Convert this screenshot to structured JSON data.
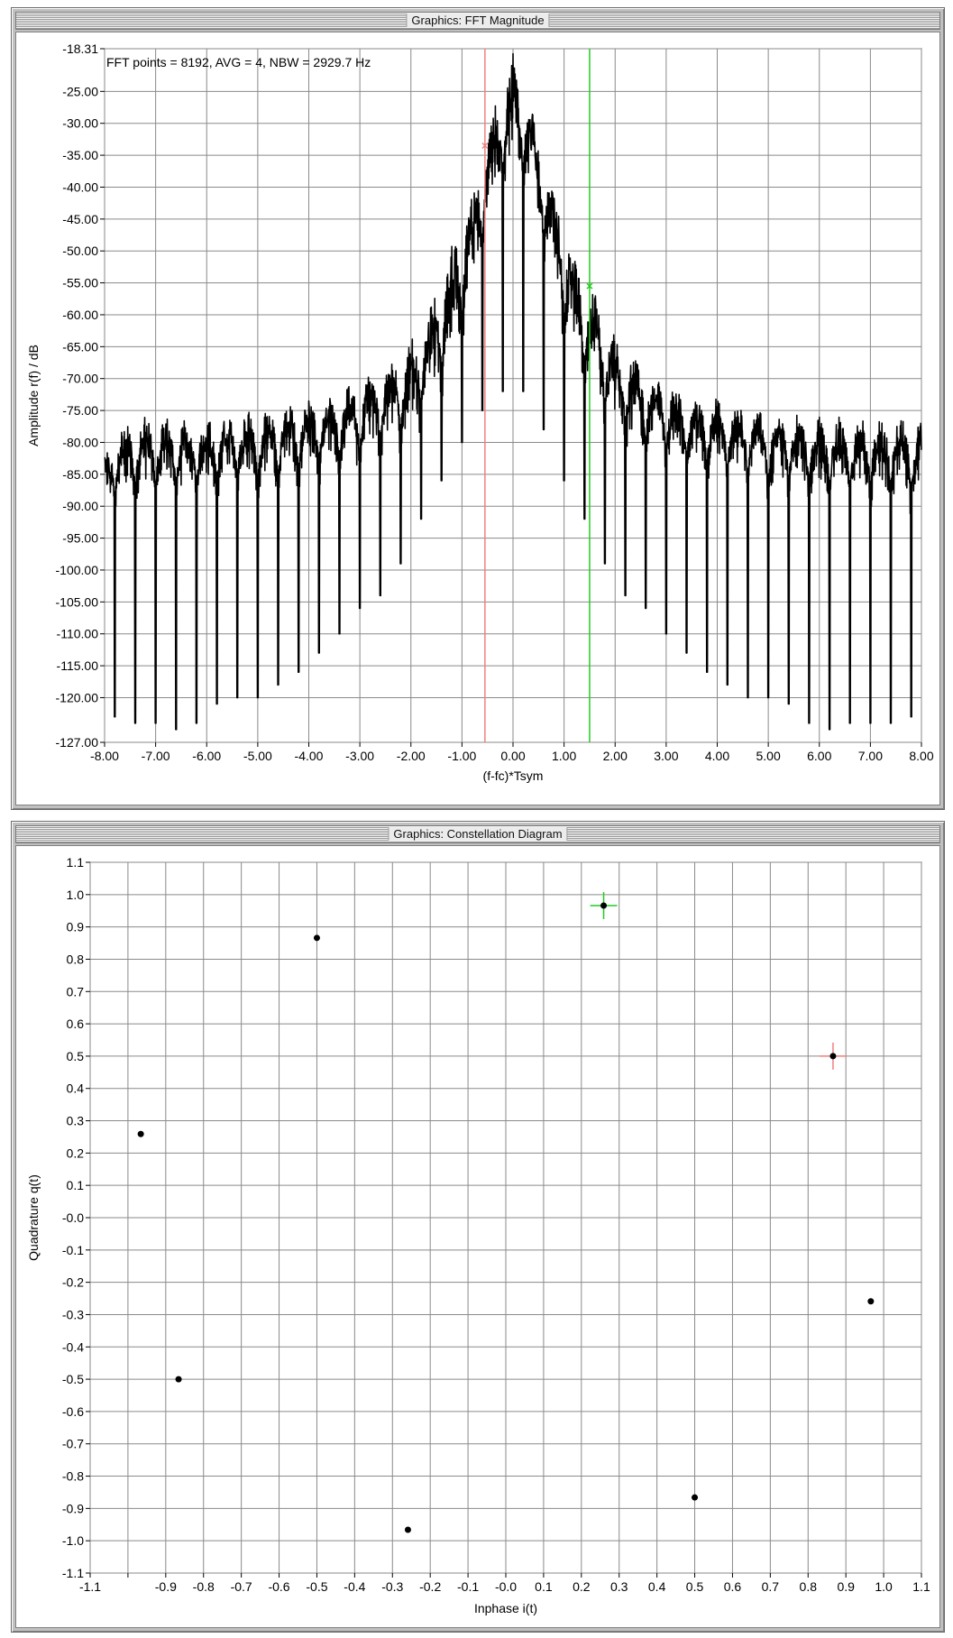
{
  "chart_data": [
    {
      "type": "line",
      "title": "Graphics: FFT Magnitude",
      "annotation": "FFT points = 8192, AVG = 4, NBW = 2929.7 Hz",
      "xlabel": "(f-fc)*Tsym",
      "ylabel": "Amplitude r(f) / dB",
      "xlim": [
        -8.0,
        8.0
      ],
      "ylim": [
        -127.0,
        -18.31
      ],
      "x_ticks": [
        "-8.00",
        "-7.00",
        "-6.00",
        "-5.00",
        "-4.00",
        "-3.00",
        "-2.00",
        "-1.00",
        "0.00",
        "1.00",
        "2.00",
        "3.00",
        "4.00",
        "5.00",
        "6.00",
        "7.00",
        "8.00"
      ],
      "y_ticks": [
        "-18.31",
        "-25.00",
        "-30.00",
        "-35.00",
        "-40.00",
        "-45.00",
        "-50.00",
        "-55.00",
        "-60.00",
        "-65.00",
        "-70.00",
        "-75.00",
        "-80.00",
        "-85.00",
        "-90.00",
        "-95.00",
        "-100.00",
        "-105.00",
        "-110.00",
        "-115.00",
        "-120.00",
        "-127.00"
      ],
      "grid": true,
      "series_color": "#000000",
      "markers": [
        {
          "x": -0.55,
          "y": -33.5,
          "color": "#f08080"
        },
        {
          "x": 1.5,
          "y": -55.5,
          "color": "#22cc22"
        }
      ],
      "envelope": {
        "x": [
          -8,
          -7.5,
          -7,
          -6.5,
          -6,
          -5.5,
          -5,
          -4.5,
          -4,
          -3.5,
          -3,
          -2.5,
          -2,
          -1.75,
          -1.5,
          -1.25,
          -1,
          -0.75,
          -0.5,
          -0.25,
          0,
          0.25,
          0.5,
          0.75,
          1,
          1.25,
          1.5,
          1.75,
          2,
          2.5,
          3,
          3.5,
          4,
          4.5,
          5,
          5.5,
          6,
          6.5,
          7,
          7.5,
          8
        ],
        "top": [
          -80,
          -76,
          -76,
          -76,
          -76,
          -75,
          -75,
          -74,
          -73,
          -72,
          -70,
          -67,
          -64,
          -60,
          -55,
          -50,
          -44,
          -38,
          -31,
          -23,
          -19,
          -24,
          -32,
          -38,
          -44,
          -50,
          -55,
          -59,
          -63,
          -67,
          -70,
          -72,
          -73,
          -74,
          -75,
          -75,
          -76,
          -76,
          -76,
          -76,
          -76
        ],
        "bottom": [
          -92,
          -90,
          -90,
          -90,
          -90,
          -89,
          -89,
          -88,
          -87,
          -86,
          -85,
          -83,
          -81,
          -78,
          -75,
          -71,
          -66,
          -58,
          -48,
          -42,
          -40,
          -42,
          -48,
          -58,
          -66,
          -71,
          -75,
          -78,
          -81,
          -83,
          -85,
          -86,
          -87,
          -88,
          -89,
          -89,
          -90,
          -90,
          -90,
          -90,
          -92
        ]
      },
      "null_depth": [
        -123,
        -124,
        -124,
        -125,
        -124,
        -121,
        -120,
        -120,
        -118,
        -116,
        -113,
        -110,
        -106,
        -104,
        -99,
        -92,
        -86,
        -80,
        -75,
        -72,
        -72,
        -78,
        -86,
        -92,
        -99,
        -104,
        -106,
        -110,
        -113,
        -116,
        -118,
        -120,
        -120,
        -121,
        -124,
        -125,
        -124,
        -124,
        -124,
        -123
      ]
    },
    {
      "type": "scatter",
      "title": "Graphics: Constellation Diagram",
      "xlabel": "Inphase i(t)",
      "ylabel": "Quadrature q(t)",
      "xlim": [
        -1.1,
        1.1
      ],
      "ylim": [
        -1.1,
        1.1
      ],
      "x_ticks": [
        "-1.1",
        "-0.9",
        "-0.8",
        "-0.7",
        "-0.6",
        "-0.5",
        "-0.4",
        "-0.3",
        "-0.2",
        "-0.1",
        "-0.0",
        "0.1",
        "0.2",
        "0.3",
        "0.4",
        "0.5",
        "0.6",
        "0.7",
        "0.8",
        "0.9",
        "1.0",
        "1.1"
      ],
      "y_ticks": [
        "1.1",
        "1.0",
        "0.9",
        "0.8",
        "0.7",
        "0.6",
        "0.5",
        "0.4",
        "0.3",
        "0.2",
        "0.1",
        "-0.0",
        "-0.1",
        "-0.2",
        "-0.3",
        "-0.4",
        "-0.5",
        "-0.6",
        "-0.7",
        "-0.8",
        "-0.9",
        "-1.0",
        "-1.1"
      ],
      "grid": true,
      "points": [
        {
          "x": -0.5,
          "y": 0.866
        },
        {
          "x": -0.966,
          "y": 0.259
        },
        {
          "x": -0.866,
          "y": -0.5
        },
        {
          "x": -0.259,
          "y": -0.966
        },
        {
          "x": 0.5,
          "y": -0.866
        },
        {
          "x": 0.966,
          "y": -0.259
        },
        {
          "x": 0.259,
          "y": 0.966
        },
        {
          "x": 0.866,
          "y": 0.5
        }
      ],
      "markers": [
        {
          "x": 0.259,
          "y": 0.966,
          "color": "#22cc22"
        },
        {
          "x": 0.866,
          "y": 0.5,
          "color": "#f08080"
        }
      ]
    }
  ]
}
